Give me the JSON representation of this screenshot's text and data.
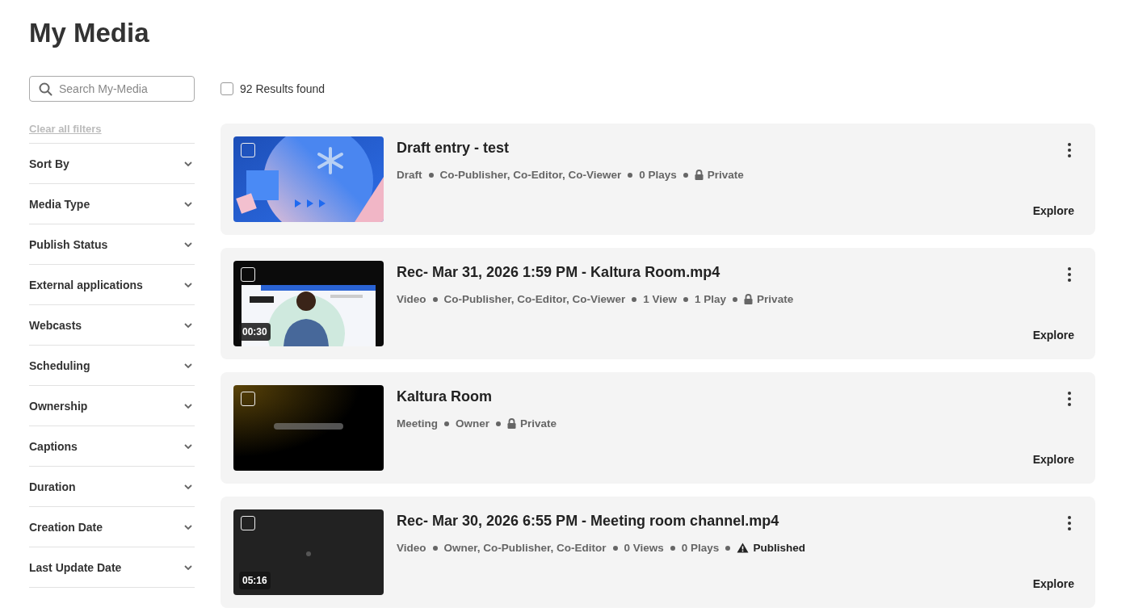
{
  "page_title": "My Media",
  "search": {
    "placeholder": "Search My-Media"
  },
  "clear_filters": "Clear all filters",
  "filters": [
    {
      "label": "Sort By",
      "expanded": false
    },
    {
      "label": "Media Type",
      "expanded": false
    },
    {
      "label": "Publish Status",
      "expanded": false
    },
    {
      "label": "External applications",
      "expanded": false
    },
    {
      "label": "Webcasts",
      "expanded": false
    },
    {
      "label": "Scheduling",
      "expanded": false
    },
    {
      "label": "Ownership",
      "expanded": false
    },
    {
      "label": "Captions",
      "expanded": false
    },
    {
      "label": "Duration",
      "expanded": false
    },
    {
      "label": "Creation Date",
      "expanded": false
    },
    {
      "label": "Last Update Date",
      "expanded": false
    }
  ],
  "results": {
    "label": "92 Results found",
    "checked": false
  },
  "entries": [
    {
      "title": "Draft entry - test",
      "checked": false,
      "meta": [
        {
          "kind": "plain",
          "text": "Draft"
        },
        {
          "kind": "plain",
          "text": "Co-Publisher, Co-Editor, Co-Viewer"
        },
        {
          "kind": "plain",
          "text": "0 Plays"
        },
        {
          "kind": "lock",
          "text": "Private"
        }
      ],
      "action": "Explore"
    },
    {
      "title": "Rec- Mar 31, 2026 1:59 PM - Kaltura Room.mp4",
      "duration": "00:30",
      "checked": false,
      "meta": [
        {
          "kind": "plain",
          "text": "Video"
        },
        {
          "kind": "plain",
          "text": "Co-Publisher, Co-Editor, Co-Viewer"
        },
        {
          "kind": "plain",
          "text": "1 View"
        },
        {
          "kind": "plain",
          "text": "1 Play"
        },
        {
          "kind": "lock",
          "text": "Private"
        }
      ],
      "action": "Explore"
    },
    {
      "title": "Kaltura Room",
      "checked": false,
      "meta": [
        {
          "kind": "plain",
          "text": "Meeting"
        },
        {
          "kind": "plain",
          "text": "Owner"
        },
        {
          "kind": "lock",
          "text": "Private"
        }
      ],
      "action": "Explore"
    },
    {
      "title": "Rec- Mar 30, 2026 6:55 PM - Meeting room channel.mp4",
      "duration": "05:16",
      "checked": false,
      "meta": [
        {
          "kind": "plain",
          "text": "Video"
        },
        {
          "kind": "plain",
          "text": "Owner, Co-Publisher, Co-Editor"
        },
        {
          "kind": "plain",
          "text": "0 Views"
        },
        {
          "kind": "plain",
          "text": "0 Plays"
        },
        {
          "kind": "warning",
          "text": "Published"
        }
      ],
      "action": "Explore"
    }
  ]
}
